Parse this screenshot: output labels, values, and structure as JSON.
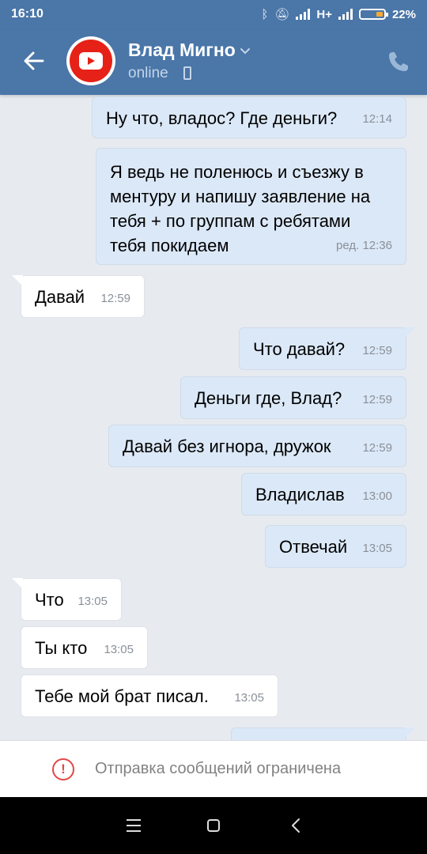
{
  "status_bar": {
    "time": "16:10",
    "network": "H+",
    "battery": "22%"
  },
  "header": {
    "contact_name": "Влад Мигно",
    "status": "online",
    "colors": {
      "header_bg": "#4a76a8",
      "status_bar_bg": "#4a76a8"
    }
  },
  "messages": [
    {
      "dir": "out",
      "text": "Ну что, владос? Где деньги?",
      "time": "12:14"
    },
    {
      "dir": "out",
      "text": "Я ведь не поленюсь и съезжу в\nментуру и напишу заявление на\nтебя + по группам с ребятами\nтебя покидаем",
      "time": "ред. 12:36"
    },
    {
      "dir": "in",
      "text": "Давай",
      "time": "12:59"
    },
    {
      "dir": "out",
      "text": "Что давай?",
      "time": "12:59"
    },
    {
      "dir": "out",
      "text": "Деньги где, Влад?",
      "time": "12:59"
    },
    {
      "dir": "out",
      "text": "Давай без игнора, дружок",
      "time": "12:59"
    },
    {
      "dir": "out",
      "text": "Владислав",
      "time": "13:00"
    },
    {
      "dir": "out",
      "text": "Отвечай",
      "time": "13:05"
    },
    {
      "dir": "in",
      "text": "Что",
      "time": "13:05"
    },
    {
      "dir": "in",
      "text": "Ты кто",
      "time": "13:05"
    },
    {
      "dir": "in",
      "text": "Тебе мой брат писал.",
      "time": "13:05"
    }
  ],
  "footer": {
    "restriction_text": "Отправка сообщений ограничена",
    "warn_symbol": "!"
  }
}
